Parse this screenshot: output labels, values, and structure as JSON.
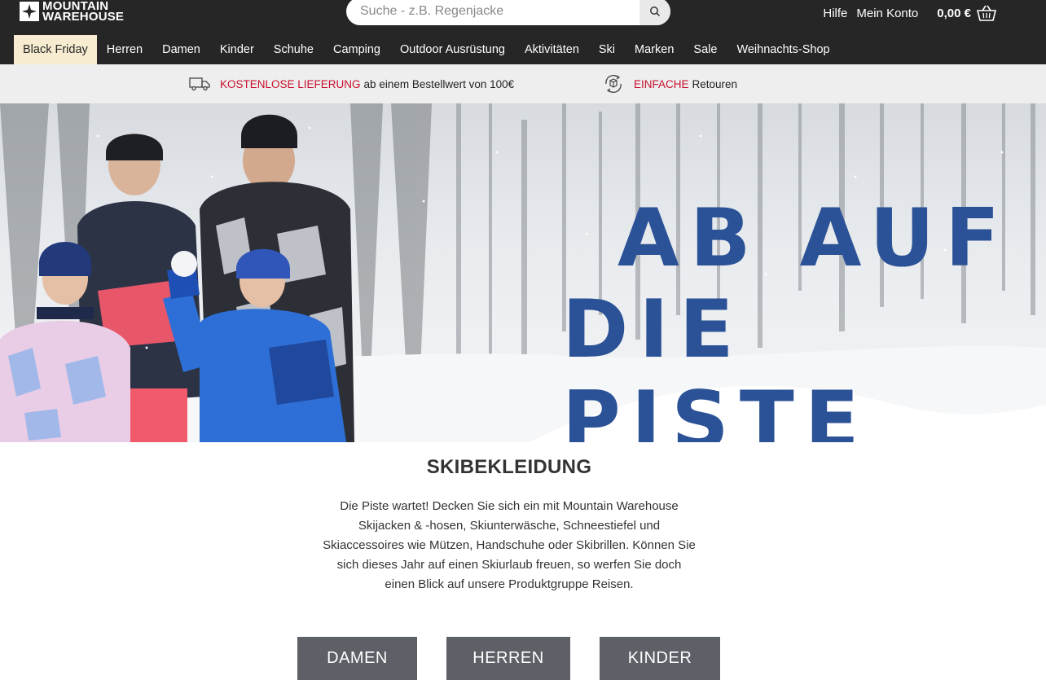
{
  "header": {
    "logo_line1": "MOUNTAIN",
    "logo_line2": "WAREHOUSE",
    "search_placeholder": "Suche - z.B. Regenjacke",
    "help": "Hilfe",
    "account": "Mein Konto",
    "cart_total": "0,00 €"
  },
  "nav": {
    "items": [
      "Black Friday",
      "Herren",
      "Damen",
      "Kinder",
      "Schuhe",
      "Camping",
      "Outdoor Ausrüstung",
      "Aktivitäten",
      "Ski",
      "Marken",
      "Sale",
      "Weihnachts-Shop"
    ]
  },
  "usp": {
    "delivery_highlight": "KOSTENLOSE LIEFERUNG",
    "delivery_text": "ab einem Bestellwert von 100€",
    "returns_highlight": "EINFACHE",
    "returns_text": "Retouren"
  },
  "hero": {
    "line1": "AB AUF",
    "line2": "DIE PISTE"
  },
  "content": {
    "heading": "SKIBEKLEIDUNG",
    "intro": "Die Piste wartet! Decken Sie sich ein mit Mountain Warehouse Skijacken & -hosen, Skiunterwäsche, Schneestiefel und Skiaccessoires wie Mützen, Handschuhe oder Skibrillen. Können Sie sich dieses Jahr auf einen Skiurlaub freuen, so werfen Sie doch einen Blick auf unsere Produktgruppe Reisen."
  },
  "cta": {
    "damen": "DAMEN",
    "herren": "HERREN",
    "kinder": "KINDER"
  },
  "colors": {
    "header_bg": "#262626",
    "active_nav_bg": "#f7ecd0",
    "accent_red": "#c8102e",
    "hero_text": "#2b5297",
    "cta_bg": "#5d6066"
  }
}
